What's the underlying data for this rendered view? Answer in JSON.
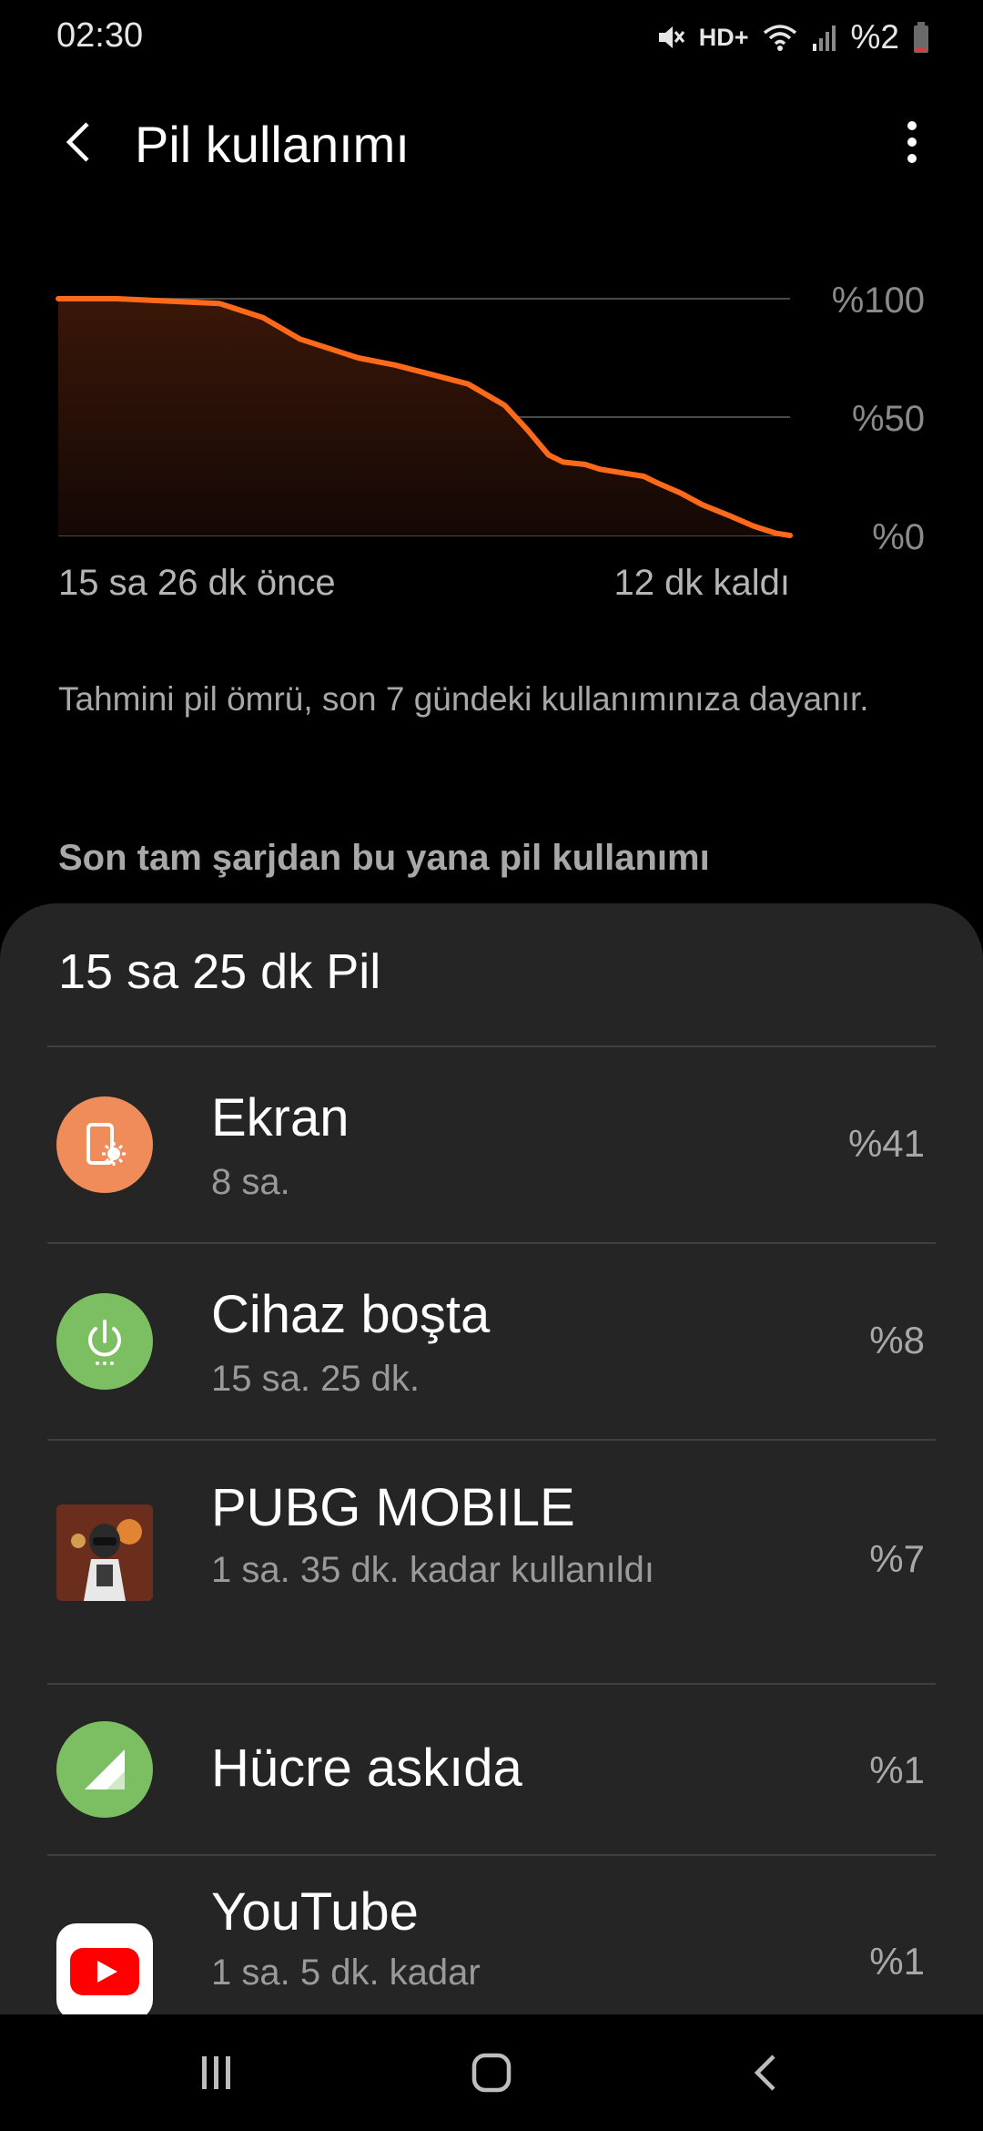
{
  "status_bar": {
    "time": "02:30",
    "network_label": "HD+",
    "battery": "%2"
  },
  "header": {
    "title": "Pil kullanımı"
  },
  "chart_data": {
    "type": "area",
    "y_tick_labels": [
      "%100",
      "%50",
      "%0"
    ],
    "x_start_label": "15 sa 26 dk önce",
    "x_end_label": "12 dk kaldı",
    "ylim": [
      0,
      100
    ],
    "line_color": "#ff6a1a",
    "x": [
      0,
      8,
      15,
      22,
      28,
      33,
      38,
      41,
      46,
      51,
      56,
      61,
      64,
      67,
      69,
      72,
      74,
      76,
      80,
      82,
      85,
      88,
      92,
      95,
      98,
      100
    ],
    "y": [
      100,
      100,
      99,
      98,
      92,
      83,
      78,
      75,
      72,
      68,
      64,
      55,
      45,
      34,
      31,
      30,
      28,
      27,
      25,
      22,
      18,
      13,
      8,
      4,
      1,
      0
    ]
  },
  "estimate_note": "Tahmini pil ömrü, son 7 gündeki kullanımınıza dayanır.",
  "section_title": "Son tam şarjdan bu yana pil kullanımı",
  "usage_card": {
    "title": "15 sa 25 dk Pil",
    "items": [
      {
        "name": "Ekran",
        "sub": "8 sa.",
        "percent": "%41",
        "icon": "screen-brightness-icon",
        "color": "#ef8c5a"
      },
      {
        "name": "Cihaz boşta",
        "sub": "15 sa. 25 dk.",
        "percent": "%8",
        "icon": "power-idle-icon",
        "color": "#7cbf62"
      },
      {
        "name": "PUBG MOBILE",
        "sub": "1 sa. 35 dk. kadar kullanıldı",
        "percent": "%7",
        "icon": "pubg-app-icon",
        "color": "#7a3a22"
      },
      {
        "name": "Hücre askıda",
        "sub": "",
        "percent": "%1",
        "icon": "cell-signal-icon",
        "color": "#7cbf62"
      },
      {
        "name": "YouTube",
        "sub": "1 sa. 5 dk. kadar",
        "percent": "%1",
        "icon": "youtube-app-icon",
        "color": "#ff0000"
      }
    ]
  },
  "nav_bar": {
    "icons": [
      "recents-icon",
      "home-icon",
      "back-icon"
    ]
  }
}
